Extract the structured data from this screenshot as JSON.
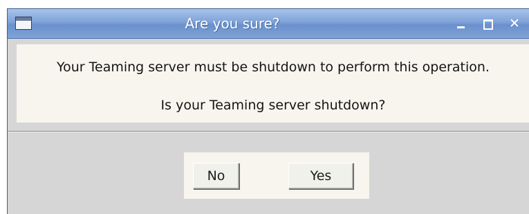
{
  "window": {
    "title": "Are you sure?",
    "close_glyph": "✕"
  },
  "message": {
    "line1": "Your Teaming server must be shutdown to perform this operation.",
    "line2": "Is your Teaming server shutdown?"
  },
  "buttons": {
    "no_label": "No",
    "yes_label": "Yes"
  },
  "icons": {
    "window_menu": "window-icon",
    "minimize": "minimize-icon",
    "maximize": "maximize-icon",
    "close": "close-icon"
  },
  "colors": {
    "titlebar": "#7ea2d8",
    "dialog_bg": "#d6d6d6",
    "panel_bg": "#f7f5ee"
  }
}
